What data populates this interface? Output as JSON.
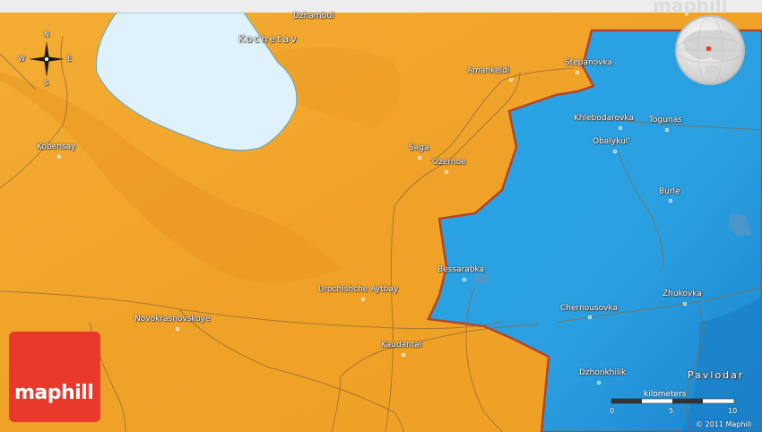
{
  "colors": {
    "land_orange": "#f2a62a",
    "land_shade": "#e48f1e",
    "region_blue": "#2aa2e2",
    "region_blue_dark": "#1a7fc8",
    "lake": "#dff2fb",
    "border_red": "#b2462a",
    "road": "#8a6a3a",
    "logo_red": "#e8392b"
  },
  "compass": {
    "n": "N",
    "s": "S",
    "e": "E",
    "w": "W"
  },
  "watermark_top": "maphill",
  "logo_text": "maphill",
  "places": [
    {
      "id": "dzhambul",
      "name": "Dzhambul"
    },
    {
      "id": "kochetav",
      "name": "Kochetav"
    },
    {
      "id": "amankeldi",
      "name": "Amankeldi"
    },
    {
      "id": "stepanovka",
      "name": "Stepanovka"
    },
    {
      "id": "khlebodarovka",
      "name": "Khlebodarovka"
    },
    {
      "id": "togunas",
      "name": "Togunas"
    },
    {
      "id": "obalykul",
      "name": "Obalykul'"
    },
    {
      "id": "kobensay",
      "name": "Kobensay"
    },
    {
      "id": "saga",
      "name": "Saga"
    },
    {
      "id": "ozernoe",
      "name": "Ozernoe"
    },
    {
      "id": "burle",
      "name": "Burle"
    },
    {
      "id": "bessarabka",
      "name": "Bessarabka"
    },
    {
      "id": "urochishche",
      "name": "Urochishche Aytbay"
    },
    {
      "id": "novokrasnovskoye",
      "name": "Novokrasnovskoye"
    },
    {
      "id": "chernousovka",
      "name": "Chernousovka"
    },
    {
      "id": "zhukovka",
      "name": "Zhukovka"
    },
    {
      "id": "kaudantal",
      "name": "Kaudantal"
    },
    {
      "id": "dzhonkhilik",
      "name": "Dzhonkhilik"
    },
    {
      "id": "pavlodar",
      "name": "Pavlodar"
    }
  ],
  "scale": {
    "title": "kilometers",
    "ticks": [
      "0",
      "5",
      "10"
    ]
  },
  "copyright": "© 2011 Maphill"
}
